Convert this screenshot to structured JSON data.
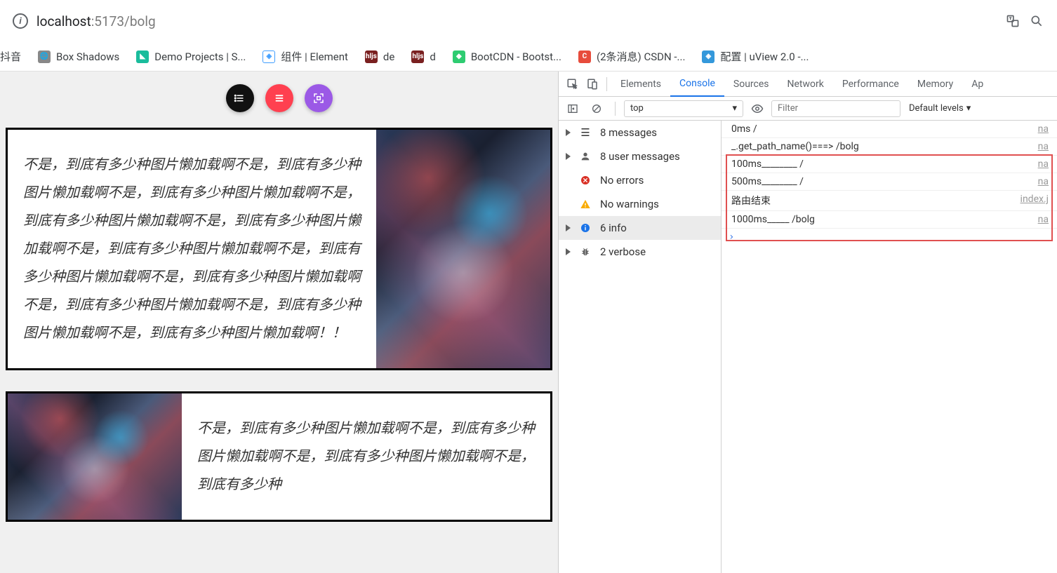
{
  "address": {
    "host": "localhost",
    "path": ":5173/bolg"
  },
  "bookmarks": [
    {
      "label": "抖音",
      "icon_color": "#000",
      "icon_text": ""
    },
    {
      "label": "Box Shadows",
      "icon_color": "#888",
      "icon_text": ""
    },
    {
      "label": "Demo Projects | S...",
      "icon_color": "#1abc9c",
      "icon_text": ""
    },
    {
      "label": "组件 | Element",
      "icon_color": "#409eff",
      "icon_text": ""
    },
    {
      "label": "de",
      "icon_color": "#7a2020",
      "icon_text": "hljs"
    },
    {
      "label": "d",
      "icon_color": "#7a2020",
      "icon_text": "hljs"
    },
    {
      "label": "BootCDN - Bootst...",
      "icon_color": "#2ecc71",
      "icon_text": ""
    },
    {
      "label": "(2条消息) CSDN -...",
      "icon_color": "#e74c3c",
      "icon_text": "C"
    },
    {
      "label": "配置 | uView 2.0 -...",
      "icon_color": "#3498db",
      "icon_text": ""
    }
  ],
  "page": {
    "card_text": "不是，到底有多少种图片懒加载啊不是，到底有多少种图片懒加载啊不是，到底有多少种图片懒加载啊不是，到底有多少种图片懒加载啊不是，到底有多少种图片懒加载啊不是，到底有多少种图片懒加载啊不是，到底有多少种图片懒加载啊不是，到底有多少种图片懒加载啊不是，到底有多少种图片懒加载啊不是，到底有多少种图片懒加载啊不是，到底有多少种图片懒加载啊！！",
    "card2_text": "不是，到底有多少种图片懒加载啊不是，到底有多少种图片懒加载啊不是，到底有多少种图片懒加载啊不是，到底有多少种"
  },
  "devtools": {
    "tabs": [
      "Elements",
      "Console",
      "Sources",
      "Network",
      "Performance",
      "Memory",
      "Ap"
    ],
    "active_tab": "Console",
    "context": "top",
    "filter_placeholder": "Filter",
    "levels": "Default levels",
    "sidebar": [
      {
        "label": "8 messages",
        "icon": "list"
      },
      {
        "label": "8 user messages",
        "icon": "user"
      },
      {
        "label": "No errors",
        "icon": "error"
      },
      {
        "label": "No warnings",
        "icon": "warn"
      },
      {
        "label": "6 info",
        "icon": "info",
        "selected": true
      },
      {
        "label": "2 verbose",
        "icon": "bug"
      }
    ],
    "log": [
      {
        "msg": "0ms /",
        "src": "na"
      },
      {
        "msg": "_.get_path_name()===> /bolg",
        "src": "na"
      },
      {
        "msg": "100ms________ /",
        "src": "na"
      },
      {
        "msg": "500ms________ /",
        "src": "na"
      },
      {
        "msg": "路由结束",
        "src": "index.j"
      },
      {
        "msg": "1000ms_____ /bolg",
        "src": "na"
      }
    ]
  }
}
